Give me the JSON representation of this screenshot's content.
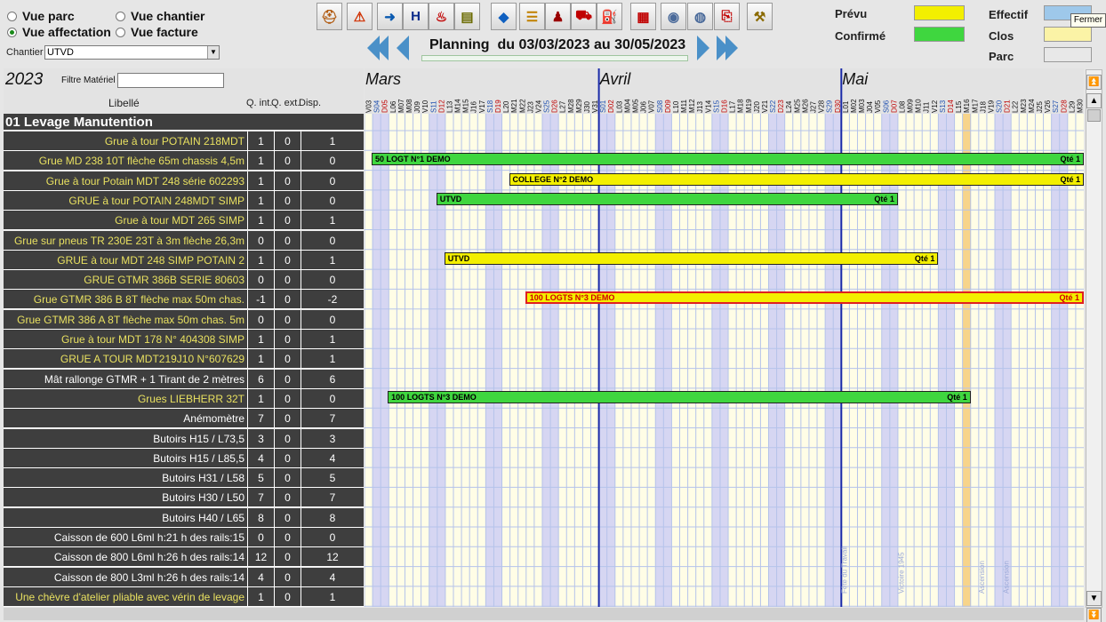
{
  "views": {
    "parc": "Vue parc",
    "chantier": "Vue chantier",
    "affectation": "Vue affectation",
    "facture": "Vue facture",
    "selected": "affectation"
  },
  "chantier": {
    "label": "Chantier",
    "value": "UTVD"
  },
  "toolbar": {
    "icons": [
      "crane-operator-icon",
      "warning-icon",
      "export-icon",
      "hospital-icon",
      "fire-extinguisher-icon",
      "stack-icon",
      "arrows-icon",
      "gantt-icon",
      "worker-icon",
      "truck-icon",
      "fuel-icon",
      "calendar-icon",
      "globe-icon",
      "globe-alt-icon",
      "pdf-icon",
      "tools-icon"
    ]
  },
  "planning": {
    "prefix": "Planning",
    "range": "du 03/03/2023 au 30/05/2023"
  },
  "legend": {
    "prevu": "Prévu",
    "prevu_color": "#f3ef00",
    "confirme": "Confirmé",
    "confirme_color": "#3fd63f",
    "effectif": "Effectif",
    "effectif_color": "#9ec8ea",
    "clos": "Clos",
    "clos_color": "#fbf3a6",
    "parc": "Parc",
    "parc_color": "#e8e8e8"
  },
  "tooltip": "Fermer",
  "year": "2023",
  "filter_label": "Filtre Matériel",
  "filter_value": "",
  "columns": {
    "libelle": "Libellé",
    "qint": "Q. int.",
    "qext": "Q. ext.",
    "disp": "Disp."
  },
  "months": [
    "Mars",
    "Avril",
    "Mai"
  ],
  "days": [
    "V03",
    "S04",
    "D05",
    "L06",
    "M07",
    "M08",
    "J09",
    "V10",
    "S11",
    "D12",
    "L13",
    "M14",
    "M15",
    "J16",
    "V17",
    "S18",
    "D19",
    "L20",
    "M21",
    "M22",
    "J23",
    "V24",
    "S25",
    "D26",
    "L27",
    "M28",
    "M29",
    "J30",
    "V31",
    "S01",
    "D02",
    "L03",
    "M04",
    "M05",
    "J06",
    "V07",
    "S08",
    "D09",
    "L10",
    "M11",
    "M12",
    "J13",
    "V14",
    "S15",
    "D16",
    "L17",
    "M18",
    "M19",
    "J20",
    "V21",
    "S22",
    "D23",
    "L24",
    "M25",
    "M26",
    "J27",
    "V28",
    "S29",
    "D30",
    "L01",
    "M02",
    "M03",
    "J04",
    "V05",
    "S06",
    "D07",
    "L08",
    "M09",
    "M10",
    "J11",
    "V12",
    "S13",
    "D14",
    "L15",
    "M16",
    "M17",
    "J18",
    "V19",
    "S20",
    "D21",
    "L22",
    "M23",
    "M24",
    "J25",
    "V26",
    "S27",
    "D28",
    "L29",
    "M30"
  ],
  "holidays": [
    "Fête du Travail",
    "Victoire 1945",
    "Ascension",
    "Ascension"
  ],
  "category": "01 Levage Manutention",
  "rows": [
    {
      "label": "Grue à tour POTAIN 218MDT",
      "qint": "1",
      "qext": "0",
      "disp": "1",
      "color": "#e8e060"
    },
    {
      "label": "Grue MD 238 10T flèche  65m chassis 4,5m",
      "qint": "1",
      "qext": "0",
      "disp": "0",
      "color": "#e8e060"
    },
    {
      "label": "Grue à tour Potain MDT 248 série 602293",
      "qint": "1",
      "qext": "0",
      "disp": "0",
      "color": "#e8e060"
    },
    {
      "label": "GRUE à tour POTAIN 248MDT SIMP",
      "qint": "1",
      "qext": "0",
      "disp": "0",
      "color": "#e8e060"
    },
    {
      "label": "Grue à tour MDT 265  SIMP",
      "qint": "1",
      "qext": "0",
      "disp": "1",
      "color": "#e8e060"
    },
    {
      "label": "Grue sur pneus TR 230E 23T à 3m flèche 26,3m",
      "qint": "0",
      "qext": "0",
      "disp": "0",
      "color": "#e8e060"
    },
    {
      "label": "GRUE à tour MDT 248  SIMP POTAIN 2",
      "qint": "1",
      "qext": "0",
      "disp": "1",
      "color": "#e8e060"
    },
    {
      "label": "GRUE GTMR 386B SERIE 80603",
      "qint": "0",
      "qext": "0",
      "disp": "0",
      "color": "#e8e060"
    },
    {
      "label": "Grue GTMR 386 B 8T flèche max 50m chas.",
      "qint": "-1",
      "qext": "0",
      "disp": "-2",
      "color": "#e8e060"
    },
    {
      "label": "Grue GTMR 386 A 8T flèche max 50m chas. 5m",
      "qint": "0",
      "qext": "0",
      "disp": "0",
      "color": "#e8e060"
    },
    {
      "label": "Grue à tour MDT 178 N° 404308  SIMP",
      "qint": "1",
      "qext": "0",
      "disp": "1",
      "color": "#e8e060"
    },
    {
      "label": "GRUE A TOUR MDT219J10 N°607629",
      "qint": "1",
      "qext": "0",
      "disp": "1",
      "color": "#e8e060"
    },
    {
      "label": "Mât rallonge GTMR + 1 Tirant de 2 mètres",
      "qint": "6",
      "qext": "0",
      "disp": "6",
      "color": "#ffffff"
    },
    {
      "label": "Grues LIEBHERR 32T",
      "qint": "1",
      "qext": "0",
      "disp": "0",
      "color": "#e8e060"
    },
    {
      "label": "Anémomètre",
      "qint": "7",
      "qext": "0",
      "disp": "7",
      "color": "#ffffff"
    },
    {
      "label": "Butoirs H15 / L73,5",
      "qint": "3",
      "qext": "0",
      "disp": "3",
      "color": "#ffffff"
    },
    {
      "label": "Butoirs H15 / L85,5",
      "qint": "4",
      "qext": "0",
      "disp": "4",
      "color": "#ffffff"
    },
    {
      "label": "Butoirs H31 / L58",
      "qint": "5",
      "qext": "0",
      "disp": "5",
      "color": "#ffffff"
    },
    {
      "label": "Butoirs H30 / L50",
      "qint": "7",
      "qext": "0",
      "disp": "7",
      "color": "#ffffff"
    },
    {
      "label": "Butoirs H40 / L65",
      "qint": "8",
      "qext": "0",
      "disp": "8",
      "color": "#ffffff"
    },
    {
      "label": "Caisson de 600 L6ml h:21 h des rails:15",
      "qint": "0",
      "qext": "0",
      "disp": "0",
      "color": "#ffffff"
    },
    {
      "label": "Caisson de 800 L6ml h:26  h des rails:14",
      "qint": "12",
      "qext": "0",
      "disp": "12",
      "color": "#ffffff"
    },
    {
      "label": "Caisson de 800 L3ml h:26 h des rails:14",
      "qint": "4",
      "qext": "0",
      "disp": "4",
      "color": "#ffffff"
    },
    {
      "label": "Une chèvre d'atelier pliable avec vérin de levage",
      "qint": "1",
      "qext": "0",
      "disp": "1",
      "color": "#e8e060"
    }
  ],
  "bars": [
    {
      "row": 1,
      "text": "50    LOGT      N°1 DEMO",
      "qte": "Qté 1",
      "start": "2023-03-03",
      "end": "2023-05-30",
      "status": "confirme"
    },
    {
      "row": 2,
      "text": "COLLEGE  N°2 DEMO",
      "qte": "Qté 1",
      "start": "2023-03-20",
      "end": "2023-05-30",
      "status": "prevu"
    },
    {
      "row": 3,
      "text": "UTVD",
      "qte": "Qté 1",
      "start": "2023-03-11",
      "end": "2023-05-07",
      "status": "confirme"
    },
    {
      "row": 6,
      "text": "UTVD",
      "qte": "Qté 1",
      "start": "2023-03-12",
      "end": "2023-05-12",
      "status": "prevu"
    },
    {
      "row": 8,
      "text": "100 LOGTS  N°3 DEMO",
      "qte": "Qté 1",
      "start": "2023-03-22",
      "end": "2023-05-30",
      "status": "conflict"
    },
    {
      "row": 13,
      "text": "100 LOGTS  N°3 DEMO",
      "qte": "Qté 1",
      "start": "2023-03-05",
      "end": "2023-05-16",
      "status": "confirme"
    }
  ],
  "status_colors": {
    "confirme": "#3fd63f",
    "prevu": "#f3ef00",
    "conflict": "#f3ef00"
  }
}
